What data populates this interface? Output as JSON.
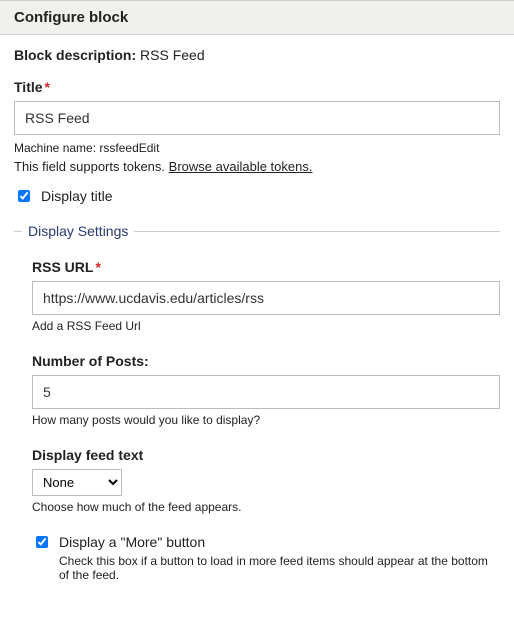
{
  "header": {
    "title": "Configure block"
  },
  "block": {
    "desc_label": "Block description:",
    "desc_value": "RSS Feed"
  },
  "title_field": {
    "label": "Title",
    "value": "RSS Feed",
    "machine_name_label": "Machine name:",
    "machine_name_value": "rssfeedEdit",
    "tokens_text": "This field supports tokens.",
    "tokens_link": "Browse available tokens."
  },
  "display_title": {
    "label": "Display title",
    "checked": true
  },
  "fieldset": {
    "legend": "Display Settings",
    "rss_url": {
      "label": "RSS URL",
      "value": "https://www.ucdavis.edu/articles/rss",
      "help": "Add a RSS Feed Url"
    },
    "num_posts": {
      "label": "Number of Posts:",
      "value": "5",
      "help": "How many posts would you like to display?"
    },
    "feed_text": {
      "label": "Display feed text",
      "selected": "None",
      "help": "Choose how much of the feed appears."
    },
    "more_button": {
      "label": "Display a \"More\" button",
      "checked": true,
      "help": "Check this box if a button to load in more feed items should appear at the bottom of the feed."
    }
  }
}
